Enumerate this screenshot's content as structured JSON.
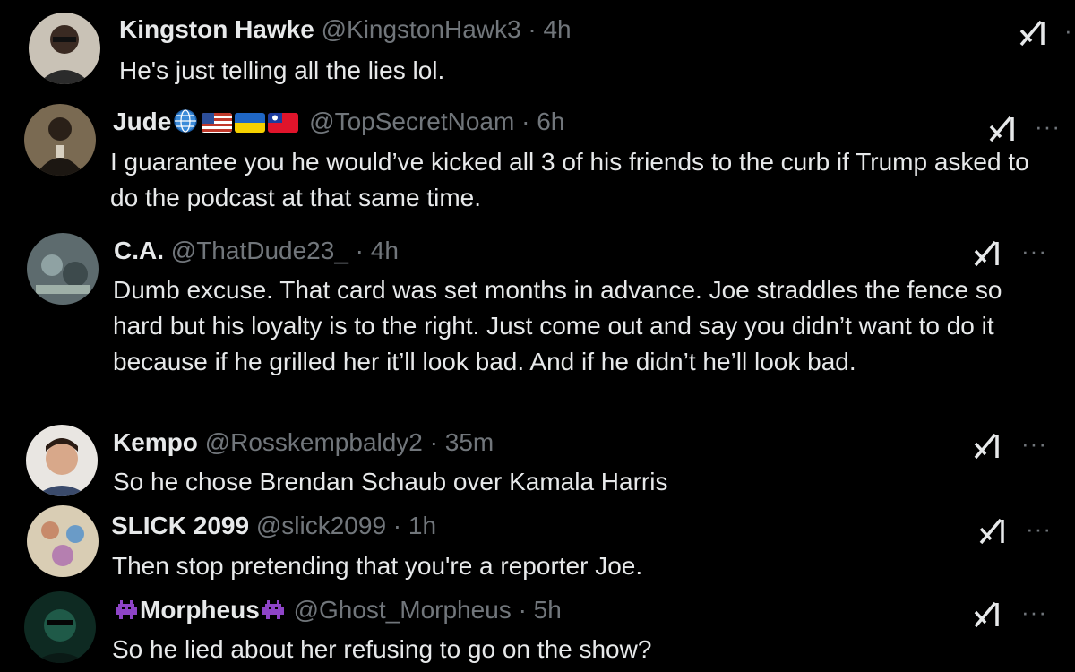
{
  "replies": [
    {
      "name": "Kingston Hawke",
      "handle": "@KingstonHawk3",
      "sep": "·",
      "time": "4h",
      "text": "He's just telling all the lies lol.",
      "more": "·"
    },
    {
      "name": "Jude",
      "handle": "@TopSecretNoam",
      "sep": "·",
      "time": "6h",
      "text": "I guarantee you he would’ve kicked all 3 of his friends to the curb if Trump asked to do the podcast at that same time.",
      "more": "···"
    },
    {
      "name": "C.A.",
      "handle": "@ThatDude23_",
      "sep": "·",
      "time": "4h",
      "text": "Dumb excuse. That card was set months in advance. Joe straddles the fence so hard but his loyalty is to the right. Just come out and say you didn’t want to do it because if he grilled her it’ll look bad. And if he didn’t he’ll look bad.",
      "more": "···"
    },
    {
      "name": "Kempo",
      "handle": "@Rosskempbaldy2",
      "sep": "·",
      "time": "35m",
      "text": "So he chose Brendan Schaub over Kamala Harris",
      "more": "···"
    },
    {
      "name": "SLICK 2099",
      "handle": "@slick2099",
      "sep": "·",
      "time": "1h",
      "text": "Then stop pretending that you're a reporter Joe.",
      "more": "···"
    },
    {
      "name": "Morpheus",
      "handle": "@Ghost_Morpheus",
      "sep": "·",
      "time": "5h",
      "text": "So he lied about her refusing to go on the show?",
      "more": "···"
    }
  ],
  "icons": {
    "grok": "grok-icon",
    "more": "more-options-icon",
    "globe": "globe-icon",
    "flags": [
      "usa-flag-icon",
      "ukraine-flag-icon",
      "taiwan-flag-icon"
    ],
    "alien": "alien-monster-icon"
  },
  "colors": {
    "background": "#000000",
    "text": "#e7e9ea",
    "secondary": "#71767b",
    "alien": "#8e44c7"
  }
}
